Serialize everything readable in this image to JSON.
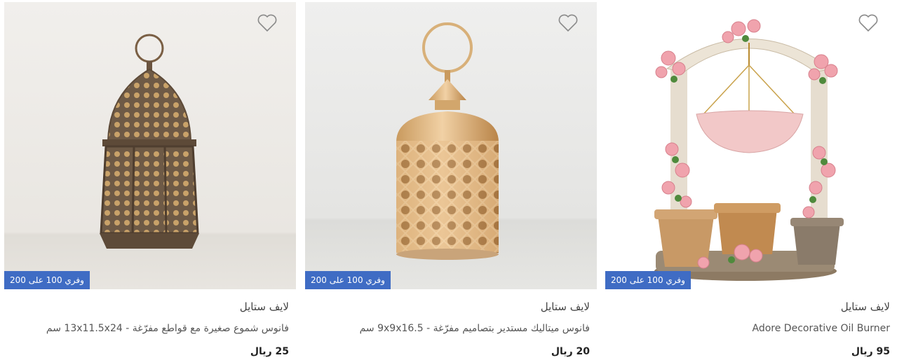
{
  "products": [
    {
      "badge": "وفري 100 على 200",
      "brand": "لايف ستايل",
      "title": "Adore Decorative Oil Burner",
      "price": "95 ريال",
      "image": "decorative-oil-burner-image",
      "favorite_icon": "heart-outline-icon"
    },
    {
      "badge": "وفري 100 على 200",
      "brand": "لايف ستايل",
      "title": "فانوس ميتاليك مستدير بتصاميم مفرّغة - 9x9x16.5 سم",
      "price": "20 ريال",
      "image": "gold-round-lantern-image",
      "favorite_icon": "heart-outline-icon"
    },
    {
      "badge": "وفري 100 على 200",
      "brand": "لايف ستايل",
      "title": "فانوس شموع صغيرة مع قواطع مفرّغة - 13x11.5x24 سم",
      "price": "25 ريال",
      "image": "bronze-candle-lantern-image",
      "favorite_icon": "heart-outline-icon"
    }
  ],
  "colors": {
    "badge_bg": "#3f6cc4",
    "price_text": "#222222"
  }
}
